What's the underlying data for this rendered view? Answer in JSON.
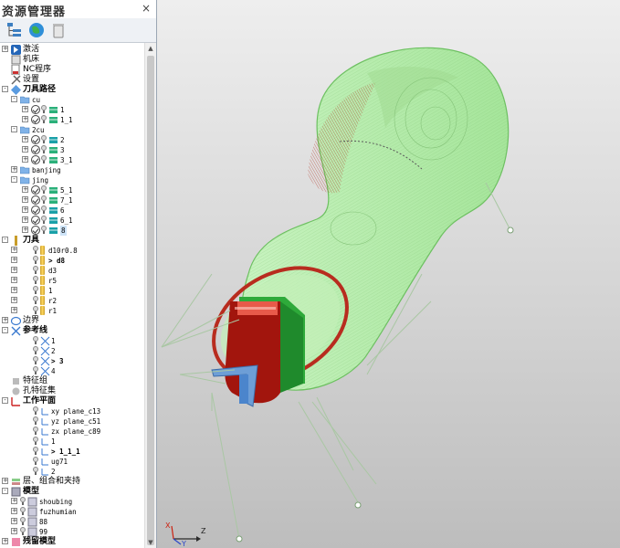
{
  "explorer": {
    "title": "资源管理器",
    "close_glyph": "×",
    "toolbar": [
      "tree-view-icon",
      "globe-icon",
      "trash-icon"
    ],
    "tree": {
      "activate": "激活",
      "machine": "机床",
      "nc_program": "NC程序",
      "settings": "设置",
      "toolpaths": {
        "label": "刀具路径",
        "folders": [
          {
            "name": "cu",
            "items": [
              "1",
              "1_1"
            ]
          },
          {
            "name": "2cu",
            "items": [
              "2",
              "3",
              "3_1"
            ]
          },
          {
            "name": "banjing",
            "items": []
          },
          {
            "name": "jing",
            "items": [
              "5_1",
              "7_1",
              "6",
              "6_1",
              "8"
            ]
          }
        ]
      },
      "tools": {
        "label": "刀具",
        "items": [
          "d10r0.8",
          "> d8",
          "d3",
          "r5",
          "1",
          "r2",
          "r1"
        ]
      },
      "boundary": "边界",
      "reference_lines": {
        "label": "参考线",
        "items": [
          "1",
          "2",
          "> 3",
          "4"
        ]
      },
      "feature_group": "特征组",
      "hole_feature_set": "孔特征集",
      "workplanes": {
        "label": "工作平面",
        "items": [
          "xy plane_c13",
          "yz plane_c51",
          "zx plane_c89",
          "1",
          "> 1_1_1",
          "ug71",
          "2"
        ]
      },
      "layers": "层、组合和夹持",
      "models": {
        "label": "模型",
        "items": [
          "shoubing",
          "fuzhumian",
          "88",
          "99"
        ]
      },
      "last_partial": "残留模型"
    }
  },
  "viewport": {
    "axis_labels": {
      "z": "Z",
      "x": "X",
      "y": "Y"
    }
  },
  "colors": {
    "toolpath_green": "#b8f0b0",
    "toolpath_red": "#b82c1f",
    "background_top": "#eeeeee",
    "background_bottom": "#bdbdbd"
  }
}
